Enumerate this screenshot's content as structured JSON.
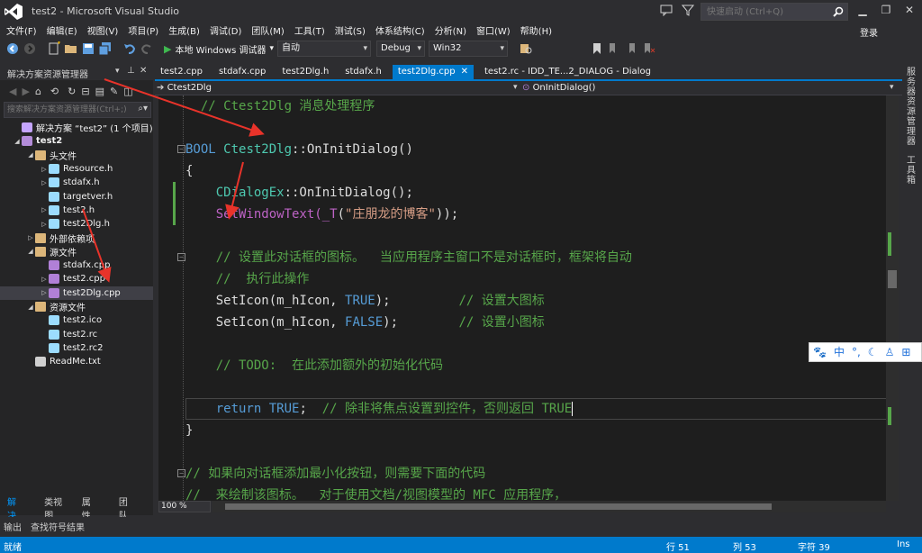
{
  "window": {
    "title": "test2 - Microsoft Visual Studio",
    "quick_launch_placeholder": "快速启动 (Ctrl+Q)",
    "login": "登录"
  },
  "menu": [
    "文件(F)",
    "编辑(E)",
    "视图(V)",
    "项目(P)",
    "生成(B)",
    "调试(D)",
    "团队(M)",
    "工具(T)",
    "测试(S)",
    "体系结构(C)",
    "分析(N)",
    "窗口(W)",
    "帮助(H)"
  ],
  "toolbar": {
    "debugger": "本地 Windows 调试器",
    "config_auto": "自动",
    "config": "Debug",
    "platform": "Win32"
  },
  "solution_explorer": {
    "title": "解决方案资源管理器",
    "search_placeholder": "搜索解决方案资源管理器(Ctrl+;)",
    "tree": [
      {
        "label": "解决方案 “test2” (1 个项目)",
        "depth": 0,
        "arrow": "",
        "icon": "solution"
      },
      {
        "label": "test2",
        "depth": 0,
        "arrow": "◢",
        "icon": "project",
        "bold": true
      },
      {
        "label": "头文件",
        "depth": 1,
        "arrow": "◢",
        "icon": "folder"
      },
      {
        "label": "Resource.h",
        "depth": 2,
        "arrow": "▷",
        "icon": "hfile"
      },
      {
        "label": "stdafx.h",
        "depth": 2,
        "arrow": "▷",
        "icon": "hfile"
      },
      {
        "label": "targetver.h",
        "depth": 2,
        "arrow": "",
        "icon": "hfile"
      },
      {
        "label": "test2.h",
        "depth": 2,
        "arrow": "▷",
        "icon": "hfile"
      },
      {
        "label": "test2Dlg.h",
        "depth": 2,
        "arrow": "▷",
        "icon": "hfile"
      },
      {
        "label": "外部依赖项",
        "depth": 1,
        "arrow": "▷",
        "icon": "folder"
      },
      {
        "label": "源文件",
        "depth": 1,
        "arrow": "◢",
        "icon": "folder"
      },
      {
        "label": "stdafx.cpp",
        "depth": 2,
        "arrow": "",
        "icon": "cppfile"
      },
      {
        "label": "test2.cpp",
        "depth": 2,
        "arrow": "▷",
        "icon": "cppfile"
      },
      {
        "label": "test2Dlg.cpp",
        "depth": 2,
        "arrow": "▷",
        "icon": "cppfile",
        "selected": true
      },
      {
        "label": "资源文件",
        "depth": 1,
        "arrow": "◢",
        "icon": "folder"
      },
      {
        "label": "test2.ico",
        "depth": 2,
        "arrow": "",
        "icon": "resfile"
      },
      {
        "label": "test2.rc",
        "depth": 2,
        "arrow": "",
        "icon": "resfile"
      },
      {
        "label": "test2.rc2",
        "depth": 2,
        "arrow": "",
        "icon": "resfile"
      },
      {
        "label": "ReadMe.txt",
        "depth": 1,
        "arrow": "",
        "icon": "txtfile"
      }
    ],
    "bottom_tabs": [
      "解决...",
      "类视图",
      "属性...",
      "团队..."
    ]
  },
  "tabs": [
    {
      "label": "test2.cpp"
    },
    {
      "label": "stdafx.cpp"
    },
    {
      "label": "test2Dlg.h"
    },
    {
      "label": "stdafx.h"
    },
    {
      "label": "test2Dlg.cpp",
      "active": true,
      "close": "✕"
    },
    {
      "label": "test2.rc - IDD_TE...2_DIALOG - Dialog"
    }
  ],
  "nav": {
    "class": "Ctest2Dlg",
    "method": "OnInitDialog()"
  },
  "code": {
    "l0": "// Ctest2Dlg 消息处理程序",
    "l2a": "BOOL",
    "l2b": "Ctest2Dlg",
    "l2c": "::OnInitDialog()",
    "l3": "{",
    "l4a": "CDialogEx",
    "l4b": "::OnInitDialog();",
    "l5a": "SetWindowText(",
    "l5b": "_T",
    "l5c": "(",
    "l5d": "\"庄朋龙的博客\"",
    "l5e": "));",
    "l7": "// 设置此对话框的图标。  当应用程序主窗口不是对话框时，框架将自动",
    "l8": "//  执行此操作",
    "l9a": "SetIcon(m_hIcon, ",
    "l9b": "TRUE",
    "l9c": ");         ",
    "l9d": "// 设置大图标",
    "l10a": "SetIcon(m_hIcon, ",
    "l10b": "FALSE",
    "l10c": ");        ",
    "l10d": "// 设置小图标",
    "l12": "// TODO:  在此添加额外的初始化代码",
    "l14a": "return",
    "l14b": "TRUE",
    "l14c": ";  ",
    "l14d": "// 除非将焦点设置到控件，否则返回 TRUE",
    "l15": "}",
    "l17": "// 如果向对话框添加最小化按钮，则需要下面的代码",
    "l18": "//  来绘制该图标。  对于使用文档/视图模型的 MFC 应用程序，"
  },
  "zoom": "100 %",
  "right_rail": [
    "服务器资源管理器",
    "工具箱"
  ],
  "ime": [
    "中",
    "°,"
  ],
  "output_tabs": [
    "输出",
    "查找符号结果"
  ],
  "status": {
    "ready": "就绪",
    "line": "行 51",
    "col": "列 53",
    "char": "字符 39",
    "mode": "Ins"
  },
  "colors": {
    "accent": "#007acc",
    "annotation_arrow": "#e8332a"
  }
}
